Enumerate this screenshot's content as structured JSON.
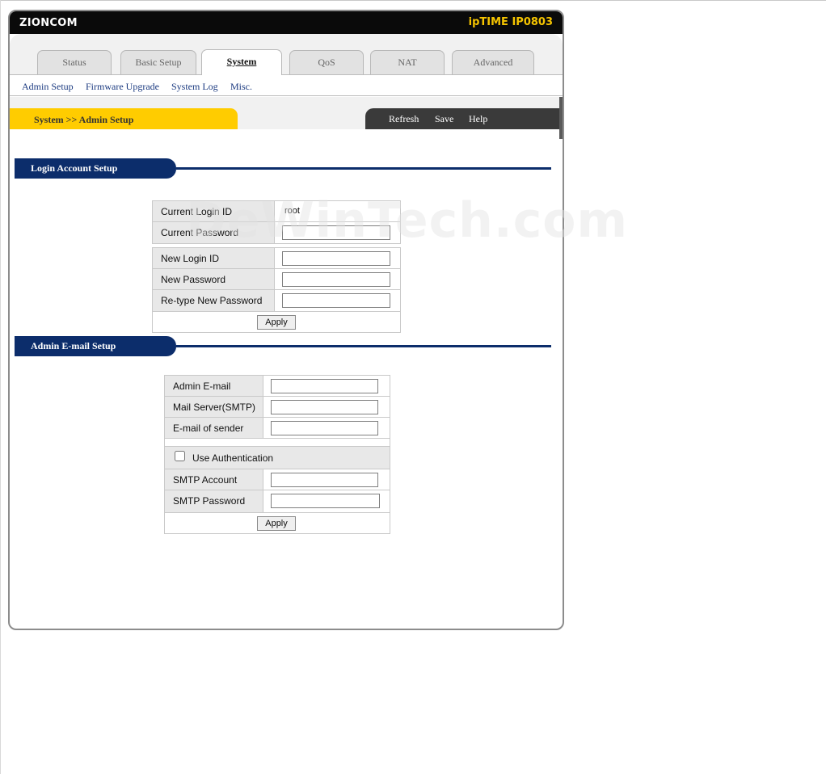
{
  "header": {
    "brand": "ZIONCOM",
    "model": "ipTIME IP0803"
  },
  "tabs": [
    {
      "label": "Status",
      "active": false
    },
    {
      "label": "Basic Setup",
      "active": false
    },
    {
      "label": "System",
      "active": true
    },
    {
      "label": "QoS",
      "active": false
    },
    {
      "label": "NAT",
      "active": false
    },
    {
      "label": "Advanced",
      "active": false
    }
  ],
  "subnav": [
    "Admin Setup",
    "Firmware Upgrade",
    "System Log",
    "Misc."
  ],
  "breadcrumb": "System >> Admin Setup",
  "actions": {
    "refresh": "Refresh",
    "save": "Save",
    "help": "Help"
  },
  "login_section": {
    "title": "Login Account Setup",
    "current_login_id_label": "Current Login ID",
    "current_login_id_value": "root",
    "current_password_label": "Current Password",
    "new_login_id_label": "New Login ID",
    "new_password_label": "New Password",
    "retype_password_label": "Re-type New Password",
    "apply": "Apply"
  },
  "email_section": {
    "title": "Admin E-mail Setup",
    "admin_email_label": "Admin E-mail",
    "mail_server_label": "Mail Server(SMTP)",
    "sender_label": "E-mail of sender",
    "use_auth_label": "Use Authentication",
    "use_auth_checked": false,
    "smtp_account_label": "SMTP Account",
    "smtp_password_label": "SMTP Password",
    "apply": "Apply"
  },
  "watermark": "DeWinTech.com",
  "colors": {
    "title_bar": "#0a0a0a",
    "model_text": "#f5c400",
    "breadcrumb": "#ffcc00",
    "section": "#0c2d6b",
    "nav_link": "#1b3a80"
  }
}
